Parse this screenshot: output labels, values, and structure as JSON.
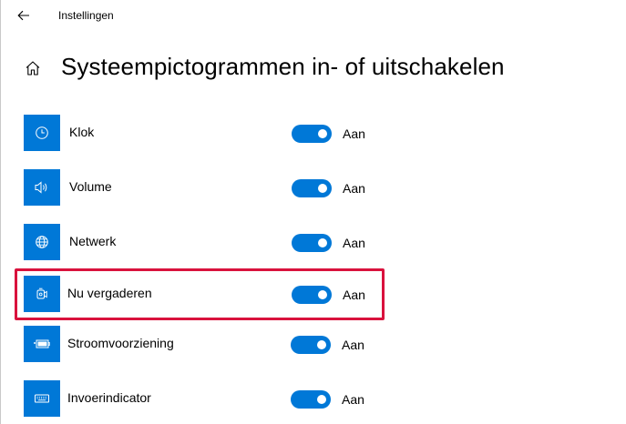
{
  "app": {
    "title": "Instellingen"
  },
  "page": {
    "title": "Systeempictogrammen in- of uitschakelen"
  },
  "items": [
    {
      "label": "Klok",
      "icon": "clock-icon",
      "state": "Aan",
      "enabled": true
    },
    {
      "label": "Volume",
      "icon": "speaker-icon",
      "state": "Aan",
      "enabled": true
    },
    {
      "label": "Netwerk",
      "icon": "globe-icon",
      "state": "Aan",
      "enabled": true
    },
    {
      "label": "Nu vergaderen",
      "icon": "meet-now-icon",
      "state": "Aan",
      "enabled": true
    },
    {
      "label": "Stroomvoorziening",
      "icon": "battery-icon",
      "state": "Aan",
      "enabled": true
    },
    {
      "label": "Invoerindicator",
      "icon": "keyboard-icon",
      "state": "Aan",
      "enabled": true
    }
  ],
  "colors": {
    "accent": "#0078d7",
    "highlight_border": "#d9123d"
  }
}
